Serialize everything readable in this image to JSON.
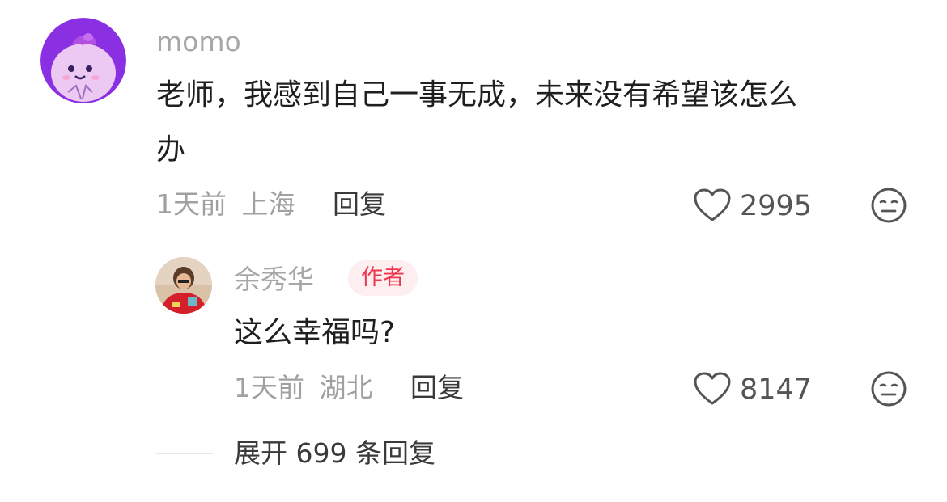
{
  "comment": {
    "username": "momo",
    "text_line1": "老师，我感到自己一事无成，未来没有希望该怎么",
    "text_line2": "办",
    "time": "1天前",
    "location": "上海",
    "reply_label": "回复",
    "likes": "2995"
  },
  "reply": {
    "username": "余秀华",
    "badge": "作者",
    "text": "这么幸福吗?",
    "time": "1天前",
    "location": "湖北",
    "reply_label": "回复",
    "likes": "8147"
  },
  "expand": {
    "label": "展开 699 条回复"
  },
  "icons": {
    "like": "heart-outline-icon",
    "dislike": "meh-face-icon"
  },
  "colors": {
    "avatar_purple": "#8a2ce0",
    "badge_text": "#f0354e",
    "badge_bg": "#fdeef0"
  }
}
